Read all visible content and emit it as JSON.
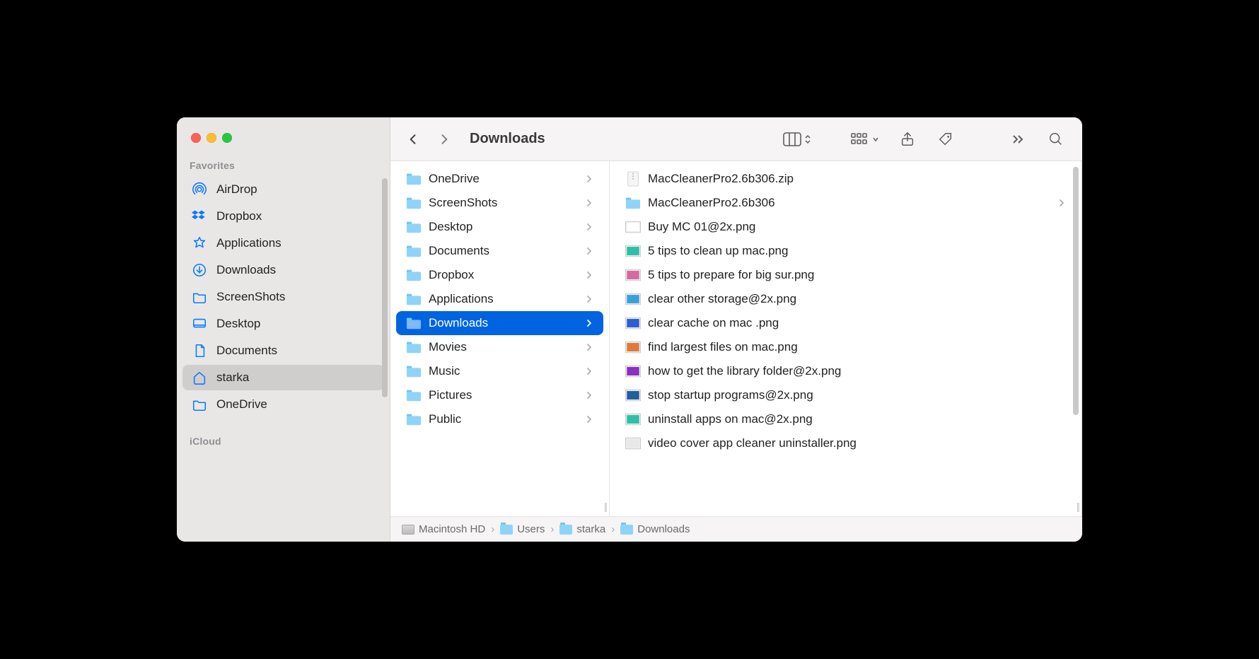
{
  "window_title": "Downloads",
  "sidebar": {
    "sections": [
      {
        "title": "Favorites"
      },
      {
        "title": "iCloud"
      }
    ],
    "favorites": [
      {
        "label": "AirDrop",
        "icon": "airdrop",
        "selected": false
      },
      {
        "label": "Dropbox",
        "icon": "dropbox",
        "selected": false
      },
      {
        "label": "Applications",
        "icon": "applications",
        "selected": false
      },
      {
        "label": "Downloads",
        "icon": "downloads",
        "selected": false
      },
      {
        "label": "ScreenShots",
        "icon": "folder",
        "selected": false
      },
      {
        "label": "Desktop",
        "icon": "desktop",
        "selected": false
      },
      {
        "label": "Documents",
        "icon": "document",
        "selected": false
      },
      {
        "label": "starka",
        "icon": "home",
        "selected": true
      },
      {
        "label": "OneDrive",
        "icon": "folder",
        "selected": false
      }
    ]
  },
  "columns": {
    "first": [
      {
        "label": "OneDrive",
        "type": "folder",
        "has_children": true,
        "selected": false
      },
      {
        "label": "ScreenShots",
        "type": "folder",
        "has_children": true,
        "selected": false
      },
      {
        "label": "Desktop",
        "type": "folder",
        "has_children": true,
        "selected": false
      },
      {
        "label": "Documents",
        "type": "folder",
        "has_children": true,
        "selected": false
      },
      {
        "label": "Dropbox",
        "type": "folder",
        "has_children": true,
        "selected": false
      },
      {
        "label": "Applications",
        "type": "folder",
        "has_children": true,
        "selected": false
      },
      {
        "label": "Downloads",
        "type": "folder",
        "has_children": true,
        "selected": true
      },
      {
        "label": "Movies",
        "type": "folder",
        "has_children": true,
        "selected": false
      },
      {
        "label": "Music",
        "type": "folder",
        "has_children": true,
        "selected": false
      },
      {
        "label": "Pictures",
        "type": "folder",
        "has_children": true,
        "selected": false
      },
      {
        "label": "Public",
        "type": "folder",
        "has_children": true,
        "selected": false
      }
    ],
    "second": [
      {
        "label": "MacCleanerPro2.6b306.zip",
        "type": "zip",
        "has_children": false,
        "thumb": "#ffffff"
      },
      {
        "label": "MacCleanerPro2.6b306",
        "type": "folder",
        "has_children": true
      },
      {
        "label": "Buy MC 01@2x.png",
        "type": "png",
        "has_children": false,
        "thumb": "#ffffff"
      },
      {
        "label": "5 tips to clean up mac.png",
        "type": "png",
        "has_children": false,
        "thumb": "#2cc0a7"
      },
      {
        "label": "5 tips to prepare for big sur.png",
        "type": "png",
        "has_children": false,
        "thumb": "#d46aa1"
      },
      {
        "label": "clear other storage@2x.png",
        "type": "png",
        "has_children": false,
        "thumb": "#3aa0d8"
      },
      {
        "label": "clear cache on mac .png",
        "type": "png",
        "has_children": false,
        "thumb": "#2c5fd1"
      },
      {
        "label": "find largest files on mac.png",
        "type": "png",
        "has_children": false,
        "thumb": "#e07a3c"
      },
      {
        "label": "how to get the library folder@2x.png",
        "type": "png",
        "has_children": false,
        "thumb": "#8a2fbf"
      },
      {
        "label": "stop startup programs@2x.png",
        "type": "png",
        "has_children": false,
        "thumb": "#1f5f9f"
      },
      {
        "label": "uninstall apps on mac@2x.png",
        "type": "png",
        "has_children": false,
        "thumb": "#2cc0a7"
      },
      {
        "label": "video cover app cleaner uninstaller.png",
        "type": "png",
        "has_children": false,
        "thumb": "#e8e8e8"
      }
    ]
  },
  "path": [
    {
      "label": "Macintosh HD",
      "icon": "disk"
    },
    {
      "label": "Users",
      "icon": "folder"
    },
    {
      "label": "starka",
      "icon": "folder"
    },
    {
      "label": "Downloads",
      "icon": "folder"
    }
  ]
}
